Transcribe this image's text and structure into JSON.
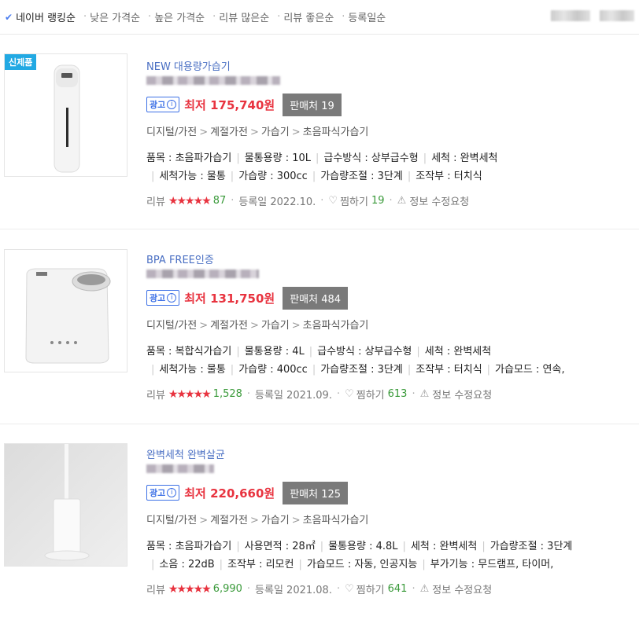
{
  "sort": {
    "items": [
      {
        "label": "네이버 랭킹순",
        "active": true
      },
      {
        "label": "낮은 가격순",
        "active": false
      },
      {
        "label": "높은 가격순",
        "active": false
      },
      {
        "label": "리뷰 많은순",
        "active": false
      },
      {
        "label": "리뷰 좋은순",
        "active": false
      },
      {
        "label": "등록일순",
        "active": false
      }
    ]
  },
  "products": [
    {
      "badge": "신제품",
      "title": "NEW 대용량가습기",
      "ad": "광고",
      "price": "최저 175,740원",
      "seller": "판매처 19",
      "category": [
        "디지털/가전",
        "계절가전",
        "가습기",
        "초음파식가습기"
      ],
      "specs_line1": [
        "품목 : 초음파가습기",
        "물통용량 : 10L",
        "급수방식 : 상부급수형",
        "세척 : 완벽세척"
      ],
      "specs_line2": [
        "세척가능 : 물통",
        "가습량 : 300cc",
        "가습량조절 : 3단계",
        "조작부 : 터치식"
      ],
      "review_label": "리뷰",
      "stars": "★★★★★",
      "review_count": "87",
      "registered": "등록일 2022.10.",
      "wish_label": "찜하기",
      "wish_count": "19",
      "report": "정보 수정요청"
    },
    {
      "badge": "",
      "title": "BPA FREE인증",
      "ad": "광고",
      "price": "최저 131,750원",
      "seller": "판매처 484",
      "category": [
        "디지털/가전",
        "계절가전",
        "가습기",
        "초음파식가습기"
      ],
      "specs_line1": [
        "품목 : 복합식가습기",
        "물통용량 : 4L",
        "급수방식 : 상부급수형",
        "세척 : 완벽세척"
      ],
      "specs_line2": [
        "세척가능 : 물통",
        "가습량 : 400cc",
        "가습량조절 : 3단계",
        "조작부 : 터치식",
        "가습모드 : 연속,"
      ],
      "review_label": "리뷰",
      "stars": "★★★★★",
      "review_count": "1,528",
      "registered": "등록일 2021.09.",
      "wish_label": "찜하기",
      "wish_count": "613",
      "report": "정보 수정요청"
    },
    {
      "badge": "",
      "title": "완벽세척 완벽살균",
      "ad": "광고",
      "price": "최저 220,660원",
      "seller": "판매처 125",
      "category": [
        "디지털/가전",
        "계절가전",
        "가습기",
        "초음파식가습기"
      ],
      "specs_line1": [
        "품목 : 초음파가습기",
        "사용면적 : 28㎡",
        "물통용량 : 4.8L",
        "세척 : 완벽세척",
        "가습량조절 : 3단계"
      ],
      "specs_line2": [
        "소음 : 22dB",
        "조작부 : 리모컨",
        "가습모드 : 자동, 인공지능",
        "부가기능 : 무드램프, 타이머,"
      ],
      "review_label": "리뷰",
      "stars": "★★★★★",
      "review_count": "6,990",
      "registered": "등록일 2021.08.",
      "wish_label": "찜하기",
      "wish_count": "641",
      "report": "정보 수정요청"
    }
  ]
}
